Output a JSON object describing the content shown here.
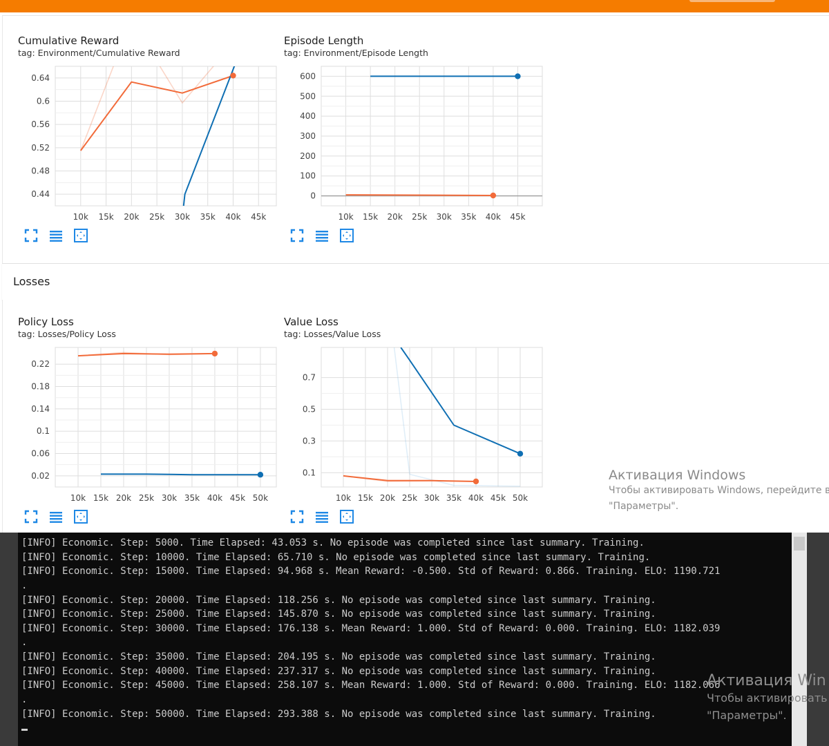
{
  "colors": {
    "top_bar": "#f57c00",
    "series_a": "#f26b3a",
    "series_b": "#0f6fb3",
    "icon": "#1e88e5"
  },
  "sections": {
    "losses": "Losses"
  },
  "charts": [
    {
      "key": "cumulative_reward",
      "title": "Cumulative Reward",
      "tag": "tag: Environment/Cumulative Reward",
      "y_ticks": [
        "0.64",
        "0.6",
        "0.56",
        "0.52",
        "0.48",
        "0.44"
      ],
      "x_ticks": [
        "10k",
        "15k",
        "20k",
        "25k",
        "30k",
        "35k",
        "40k",
        "45k"
      ]
    },
    {
      "key": "episode_length",
      "title": "Episode Length",
      "tag": "tag: Environment/Episode Length",
      "y_ticks": [
        "600",
        "500",
        "400",
        "300",
        "200",
        "100",
        "0"
      ],
      "x_ticks": [
        "10k",
        "15k",
        "20k",
        "25k",
        "30k",
        "35k",
        "40k",
        "45k"
      ]
    },
    {
      "key": "policy_loss",
      "title": "Policy Loss",
      "tag": "tag: Losses/Policy Loss",
      "y_ticks": [
        "0.22",
        "0.18",
        "0.14",
        "0.1",
        "0.06",
        "0.02"
      ],
      "x_ticks": [
        "10k",
        "15k",
        "20k",
        "25k",
        "30k",
        "35k",
        "40k",
        "45k",
        "50k"
      ]
    },
    {
      "key": "value_loss",
      "title": "Value Loss",
      "tag": "tag: Losses/Value Loss",
      "y_ticks": [
        "0.7",
        "0.5",
        "0.3",
        "0.1"
      ],
      "x_ticks": [
        "10k",
        "15k",
        "20k",
        "25k",
        "30k",
        "35k",
        "40k",
        "45k",
        "50k"
      ]
    }
  ],
  "chart_data": [
    {
      "type": "line",
      "title": "Cumulative Reward",
      "x_ticks": [
        "10k",
        "15k",
        "20k",
        "25k",
        "30k",
        "35k",
        "40k",
        "45k"
      ],
      "y_ticks": [
        0.64,
        0.6,
        0.56,
        0.52,
        0.48,
        0.44
      ],
      "xlim": [
        5000,
        48500
      ],
      "ylim": [
        0.42,
        0.66
      ],
      "grid": true,
      "series": [
        {
          "color": "#f26b3a",
          "x": [
            10000,
            20000,
            30000,
            40000
          ],
          "y": [
            0.515,
            0.633,
            0.614,
            0.644
          ]
        },
        {
          "color": "#f26b3a",
          "faint": true,
          "x": [
            10000,
            20000,
            30000,
            40000
          ],
          "y": [
            0.515,
            0.74,
            0.597,
            0.7
          ]
        },
        {
          "color": "#0f6fb3",
          "x": [
            30000,
            30500,
            42000
          ],
          "y": [
            0.4,
            0.44,
            0.7
          ]
        }
      ]
    },
    {
      "type": "line",
      "title": "Episode Length",
      "x_ticks": [
        "10k",
        "15k",
        "20k",
        "25k",
        "30k",
        "35k",
        "40k",
        "45k"
      ],
      "y_ticks": [
        600,
        500,
        400,
        300,
        200,
        100,
        0
      ],
      "xlim": [
        5000,
        50000
      ],
      "ylim": [
        -50,
        650
      ],
      "grid": true,
      "series": [
        {
          "color": "#f26b3a",
          "x": [
            10000,
            40000
          ],
          "y": [
            5,
            2
          ]
        },
        {
          "color": "#0f6fb3",
          "x": [
            15000,
            45000
          ],
          "y": [
            600,
            600
          ]
        }
      ]
    },
    {
      "type": "line",
      "title": "Policy Loss",
      "x_ticks": [
        "10k",
        "15k",
        "20k",
        "25k",
        "30k",
        "35k",
        "40k",
        "45k",
        "50k"
      ],
      "y_ticks": [
        0.22,
        0.18,
        0.14,
        0.1,
        0.06,
        0.02
      ],
      "xlim": [
        5000,
        53500
      ],
      "ylim": [
        0.0,
        0.25
      ],
      "grid": true,
      "series": [
        {
          "color": "#f26b3a",
          "x": [
            10000,
            20000,
            30000,
            40000
          ],
          "y": [
            0.235,
            0.239,
            0.238,
            0.239
          ]
        },
        {
          "color": "#f26b3a",
          "faint": true,
          "x": [
            10000,
            20000,
            30000,
            40000
          ],
          "y": [
            0.235,
            0.241,
            0.237,
            0.239
          ]
        },
        {
          "color": "#0f6fb3",
          "x": [
            15000,
            25000,
            35000,
            50000
          ],
          "y": [
            0.023,
            0.023,
            0.022,
            0.022
          ]
        }
      ]
    },
    {
      "type": "line",
      "title": "Value Loss",
      "x_ticks": [
        "10k",
        "15k",
        "20k",
        "25k",
        "30k",
        "35k",
        "40k",
        "45k",
        "50k"
      ],
      "y_ticks": [
        0.7,
        0.5,
        0.3,
        0.1
      ],
      "xlim": [
        5000,
        55000
      ],
      "ylim": [
        0.01,
        0.89
      ],
      "grid": true,
      "series": [
        {
          "color": "#f26b3a",
          "x": [
            10000,
            20000,
            30000,
            40000
          ],
          "y": [
            0.08,
            0.05,
            0.05,
            0.045
          ]
        },
        {
          "color": "#f26b3a",
          "faint": true,
          "x": [
            10000,
            20000,
            30000,
            40000
          ],
          "y": [
            0.08,
            0.045,
            0.048,
            0.045
          ]
        },
        {
          "color": "#0f6fb3",
          "x": [
            23000,
            25000,
            35000,
            50000
          ],
          "y": [
            0.89,
            0.81,
            0.4,
            0.22
          ]
        },
        {
          "color": "#8ec3e6",
          "faint": true,
          "x": [
            21500,
            25000,
            35000,
            50000
          ],
          "y": [
            0.89,
            0.09,
            0.02,
            0.015
          ]
        }
      ]
    }
  ],
  "toolbar_icons": [
    "fullscreen-icon",
    "data-table-icon",
    "fit-domain-icon"
  ],
  "watermark": {
    "title": "Активация Windows",
    "line1": "Чтобы активировать Windows, перейдите в",
    "line2": "\"Параметры\"."
  },
  "console": {
    "lines": [
      "[INFO] Economic. Step: 5000. Time Elapsed: 43.053 s. No episode was completed since last summary. Training.",
      "[INFO] Economic. Step: 10000. Time Elapsed: 65.710 s. No episode was completed since last summary. Training.",
      "[INFO] Economic. Step: 15000. Time Elapsed: 94.968 s. Mean Reward: -0.500. Std of Reward: 0.866. Training. ELO: 1190.721",
      ".",
      "[INFO] Economic. Step: 20000. Time Elapsed: 118.256 s. No episode was completed since last summary. Training.",
      "[INFO] Economic. Step: 25000. Time Elapsed: 145.870 s. No episode was completed since last summary. Training.",
      "[INFO] Economic. Step: 30000. Time Elapsed: 176.138 s. Mean Reward: 1.000. Std of Reward: 0.000. Training. ELO: 1182.039",
      ".",
      "[INFO] Economic. Step: 35000. Time Elapsed: 204.195 s. No episode was completed since last summary. Training.",
      "[INFO] Economic. Step: 40000. Time Elapsed: 237.317 s. No episode was completed since last summary. Training.",
      "[INFO] Economic. Step: 45000. Time Elapsed: 258.107 s. Mean Reward: 1.000. Std of Reward: 0.000. Training. ELO: 1182.066",
      ".",
      "[INFO] Economic. Step: 50000. Time Elapsed: 293.388 s. No episode was completed since last summary. Training."
    ],
    "watermark_title": "Активация Win",
    "watermark_line1": "Чтобы активировать",
    "watermark_line2": "\"Параметры\"."
  }
}
